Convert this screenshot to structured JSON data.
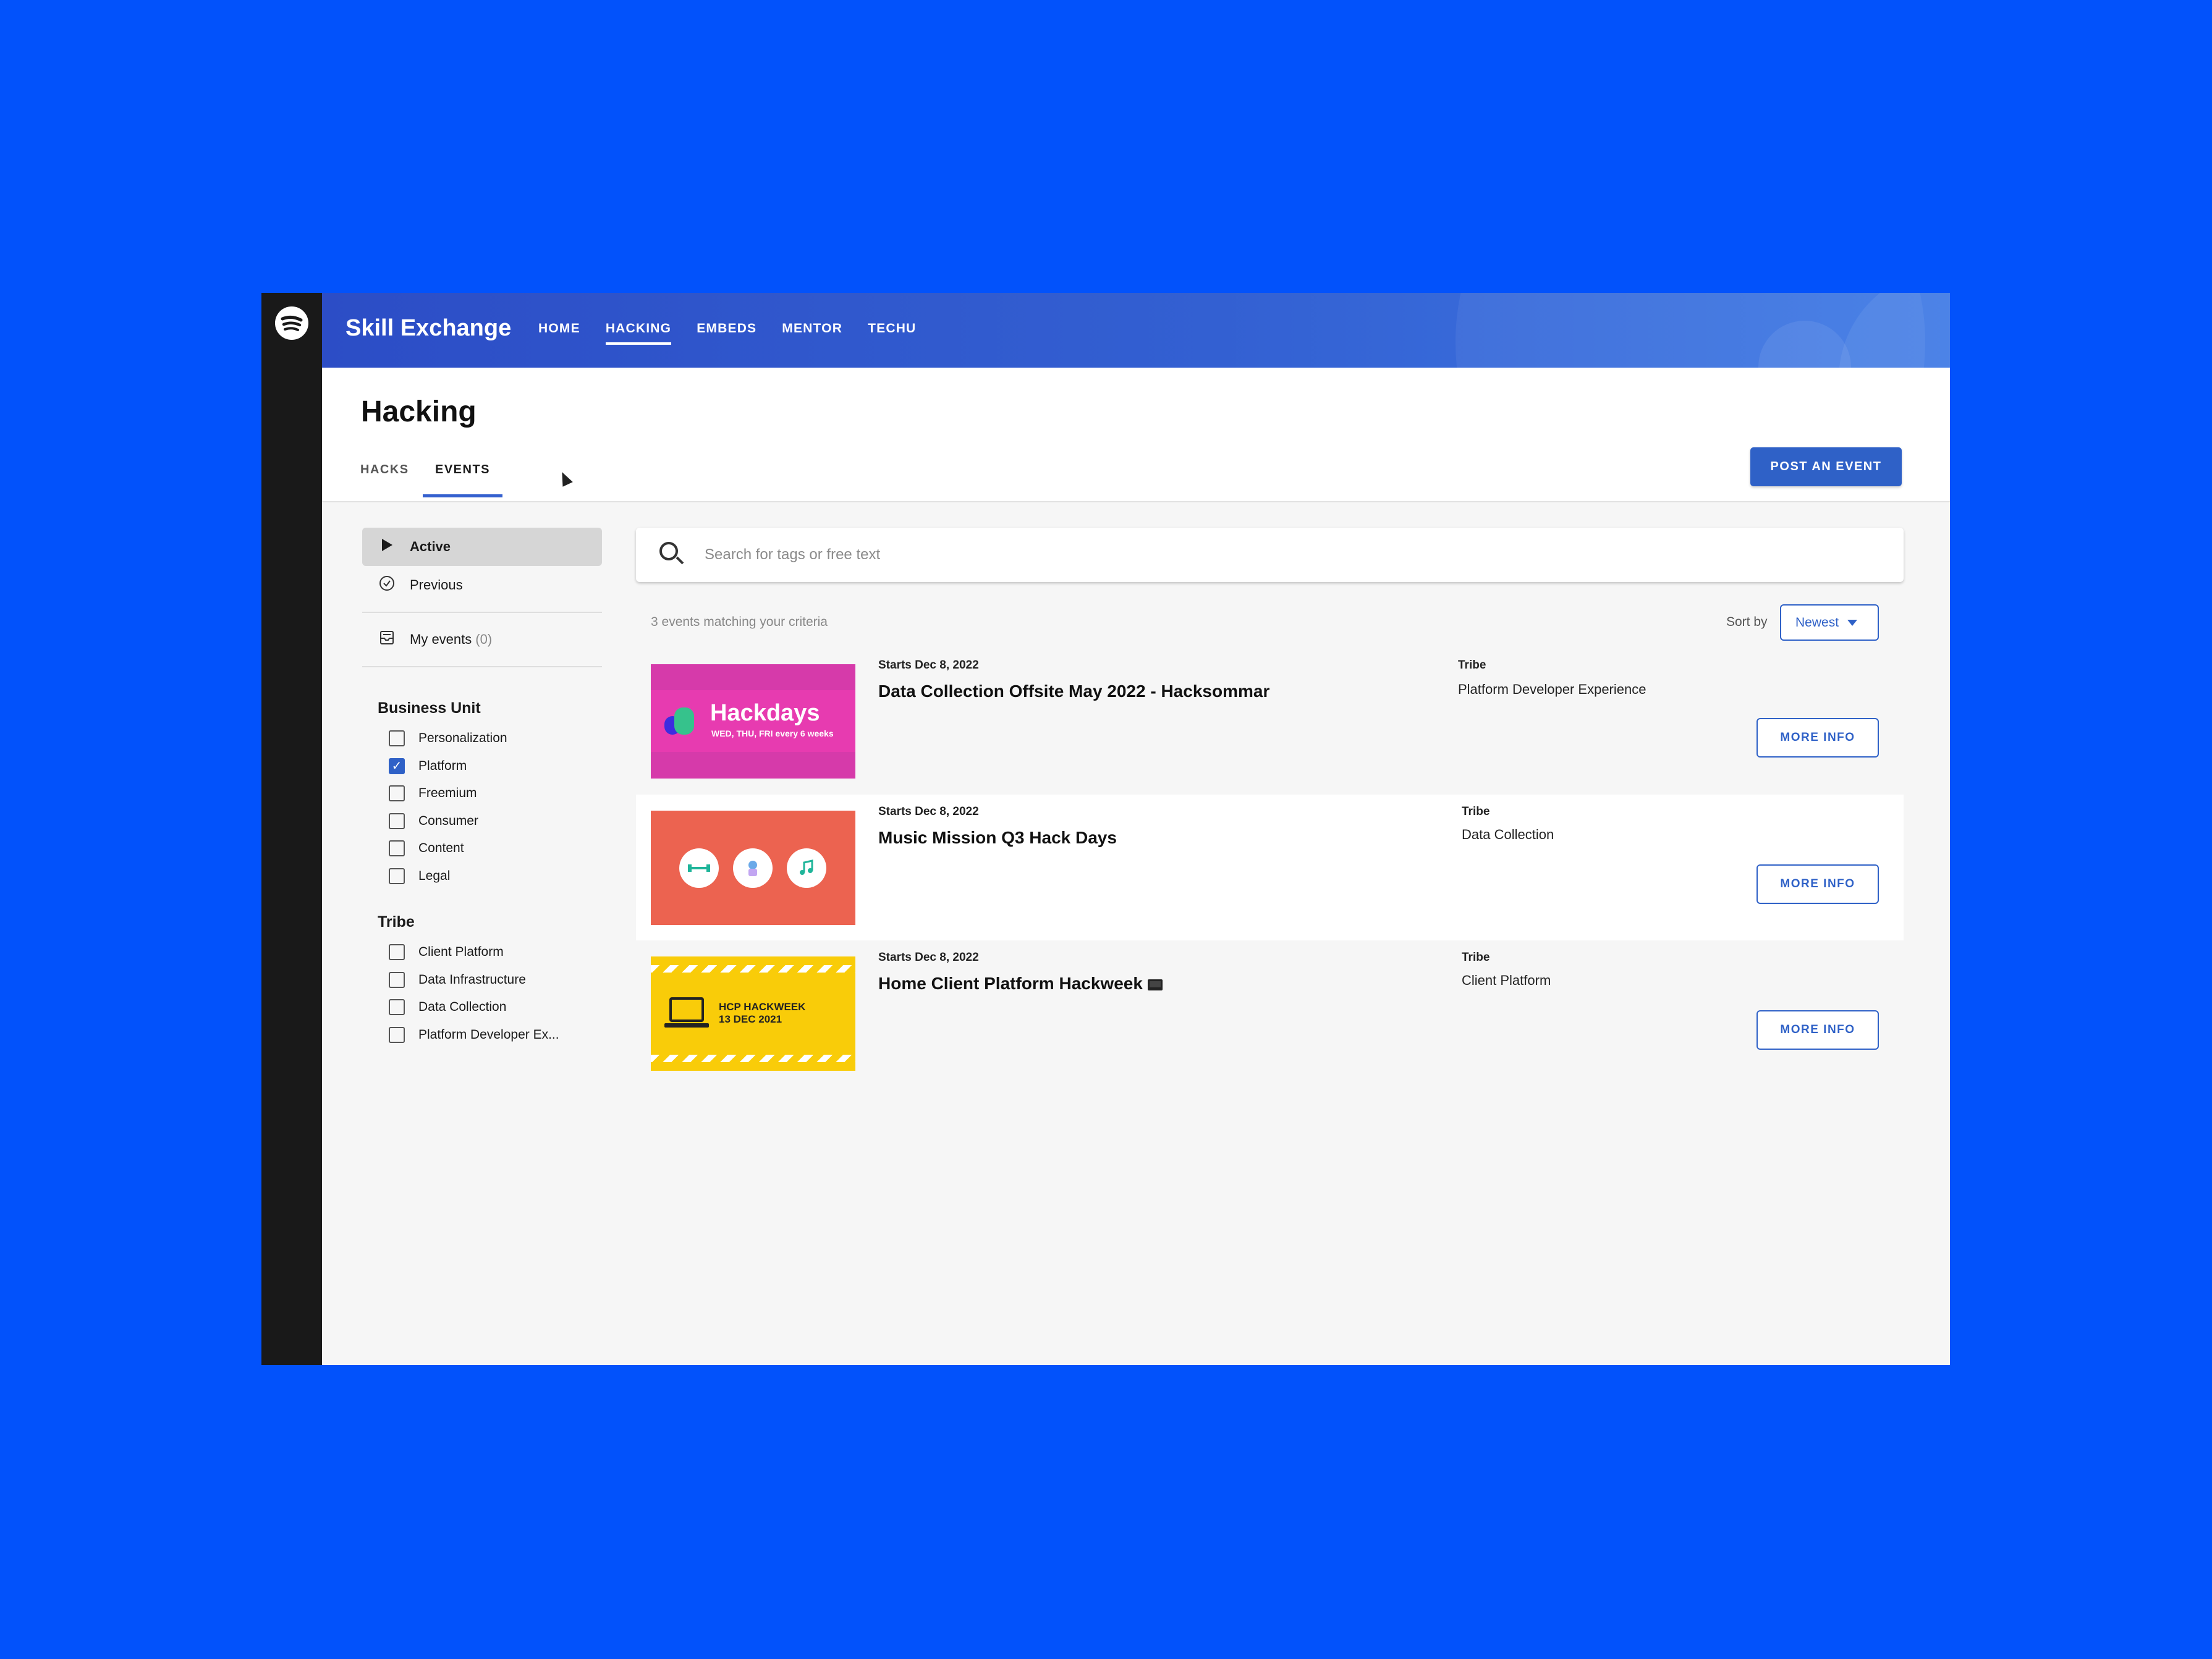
{
  "app": {
    "brand": "Skill Exchange"
  },
  "nav": [
    "HOME",
    "HACKING",
    "EMBEDS",
    "MENTOR",
    "TECHU"
  ],
  "nav_active": "HACKING",
  "page": {
    "title": "Hacking",
    "subtabs": [
      "HACKS",
      "EVENTS"
    ],
    "active_subtab": "EVENTS",
    "post_button": "POST AN EVENT"
  },
  "sidebar": {
    "status_items": [
      {
        "label": "Active",
        "icon": "play-icon"
      },
      {
        "label": "Previous",
        "icon": "check-circle-icon"
      }
    ],
    "my_events": {
      "label": "My events",
      "count": "(0)"
    },
    "business_unit": {
      "title": "Business Unit",
      "options": [
        {
          "label": "Personalization",
          "checked": false
        },
        {
          "label": "Platform",
          "checked": true
        },
        {
          "label": "Freemium",
          "checked": false
        },
        {
          "label": "Consumer",
          "checked": false
        },
        {
          "label": "Content",
          "checked": false
        },
        {
          "label": "Legal",
          "checked": false
        }
      ]
    },
    "tribe": {
      "title": "Tribe",
      "options": [
        {
          "label": "Client Platform",
          "checked": false
        },
        {
          "label": "Data Infrastructure",
          "checked": false
        },
        {
          "label": "Data Collection",
          "checked": false
        },
        {
          "label": "Platform Developer Ex...",
          "checked": false
        }
      ]
    }
  },
  "search": {
    "placeholder": "Search for tags or free text",
    "value": ""
  },
  "results": {
    "summary": "3 events matching your criteria",
    "sort_label": "Sort by",
    "sort_value": "Newest"
  },
  "events": [
    {
      "date": "Starts Dec 8, 2022",
      "title": "Data Collection Offsite May 2022 - Hacksommar",
      "tribe_label": "Tribe",
      "tribe": "Platform Developer Experience",
      "button": "MORE INFO",
      "thumb": {
        "title": "Hackdays",
        "subtitle": "WED, THU, FRI every 6 weeks"
      }
    },
    {
      "date": "Starts Dec 8, 2022",
      "title": "Music Mission Q3 Hack Days",
      "tribe_label": "Tribe",
      "tribe": "Data Collection",
      "button": "MORE INFO"
    },
    {
      "date": "Starts Dec 8, 2022",
      "title": "Home Client Platform Hackweek",
      "tribe_label": "Tribe",
      "tribe": "Client Platform",
      "button": "MORE INFO",
      "thumb": {
        "line1": "HCP HACKWEEK",
        "line2": "13 DEC 2021"
      }
    }
  ],
  "colors": {
    "accent": "#2f61c7",
    "background": "#0252fb",
    "rail": "#191919"
  }
}
